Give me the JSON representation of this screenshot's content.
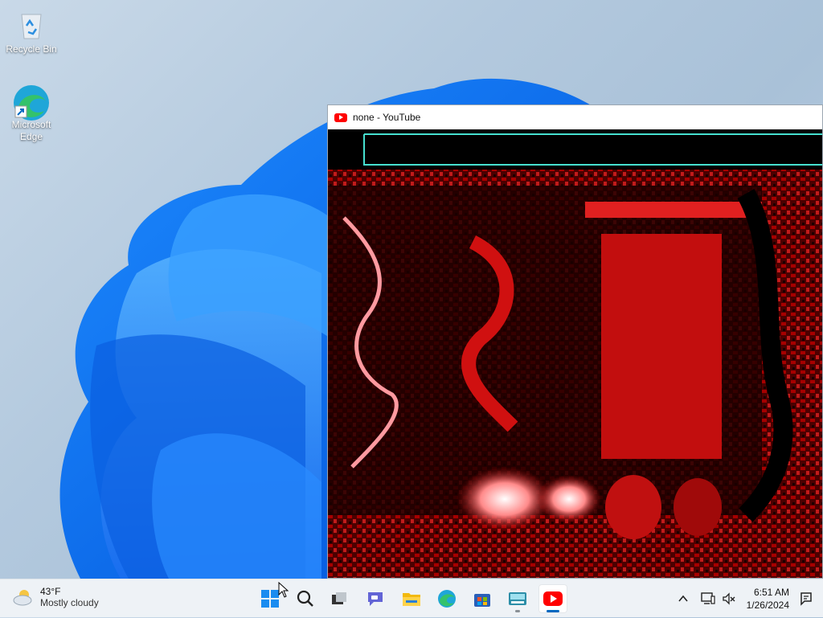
{
  "desktop": {
    "icons": [
      {
        "label": "Recycle Bin",
        "icon": "recycle-bin-icon"
      },
      {
        "label": "Microsoft Edge",
        "icon": "edge-icon"
      }
    ]
  },
  "window": {
    "title": "none - YouTube",
    "app_icon": "youtube-icon",
    "content": "video-player"
  },
  "taskbar": {
    "weather": {
      "temp": "43°F",
      "condition": "Mostly cloudy",
      "icon": "cloudy-weather-icon"
    },
    "apps": [
      {
        "name": "Start",
        "icon": "windows-start-icon"
      },
      {
        "name": "Search",
        "icon": "search-icon"
      },
      {
        "name": "Task View",
        "icon": "task-view-icon"
      },
      {
        "name": "Chat",
        "icon": "chat-icon"
      },
      {
        "name": "File Explorer",
        "icon": "file-explorer-icon"
      },
      {
        "name": "Microsoft Edge",
        "icon": "edge-icon"
      },
      {
        "name": "Microsoft Store",
        "icon": "store-icon"
      },
      {
        "name": "Touch Keyboard / App",
        "icon": "keyboard-app-icon"
      },
      {
        "name": "YouTube",
        "icon": "youtube-icon"
      }
    ],
    "tray": {
      "chevron": "chevron-up-icon",
      "network": "network-icon",
      "volume": "volume-muted-icon",
      "notification": "notification-icon"
    },
    "clock": {
      "time": "6:51 AM",
      "date": "1/26/2024"
    }
  },
  "colors": {
    "taskbar_bg": "#eef2f6",
    "accent": "#0067c0",
    "youtube_red": "#ff0000"
  }
}
